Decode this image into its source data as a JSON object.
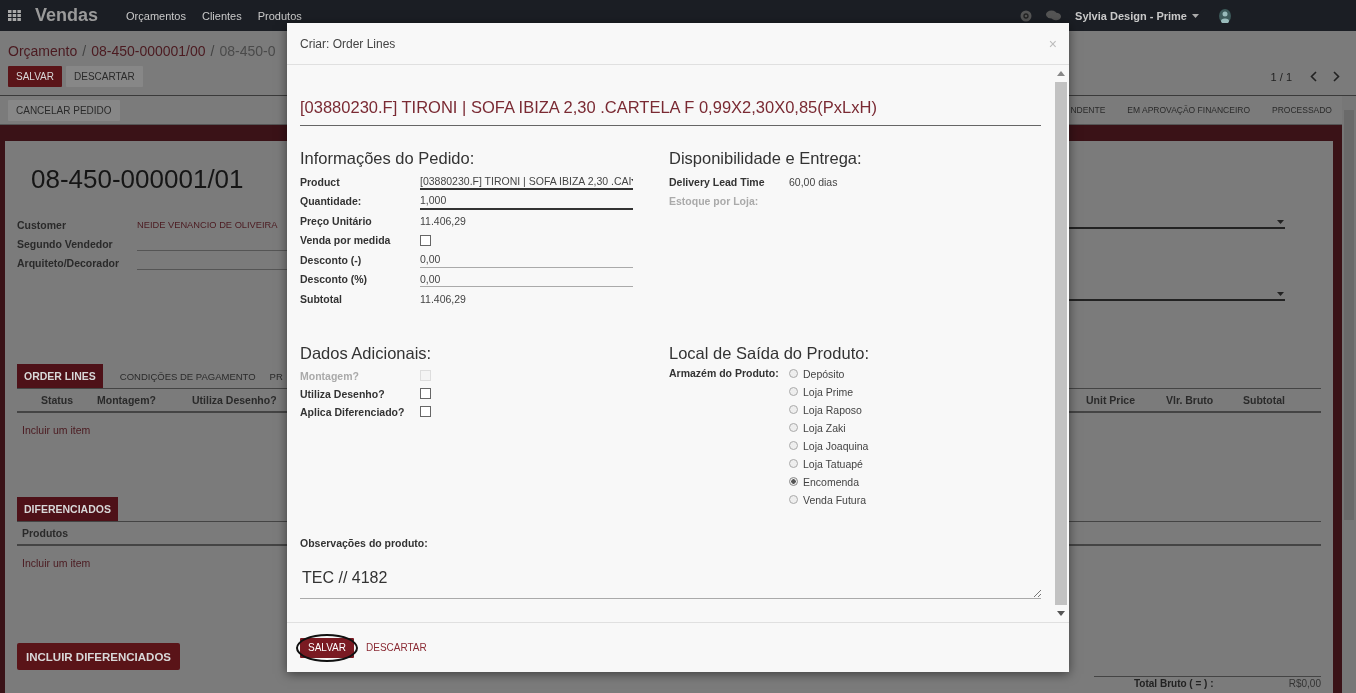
{
  "topbar": {
    "app": "Vendas",
    "menu": [
      "Orçamentos",
      "Clientes",
      "Produtos"
    ],
    "user": "Sylvia Design - Prime"
  },
  "control_panel": {
    "breadcrumb": {
      "separator": "/",
      "items": [
        "Orçamento",
        "08-450-000001/00",
        "08-450-0"
      ]
    },
    "buttons": [
      {
        "label": "SALVAR",
        "kind": "primary"
      },
      {
        "label": "DESCARTAR",
        "kind": "secondary"
      }
    ],
    "pager": "1 / 1"
  },
  "statusbar": {
    "buttons": [
      "CANCELAR PEDIDO"
    ],
    "stages": [
      "NDENTE",
      "EM APROVAÇÃO FINANCEIRO",
      "PROCESSADO"
    ]
  },
  "sheet": {
    "title": "08-450-000001/01",
    "fields": [
      {
        "label": "Customer",
        "value": "NEIDE VENANCIO DE OLIVEIRA"
      },
      {
        "label": "Segundo Vendedor"
      },
      {
        "label": "Arquiteto/Decorador"
      }
    ],
    "tabs": [
      {
        "label": "ORDER LINES",
        "selected": true
      },
      {
        "label": "CONDIÇÕES DE PAGAMENTO",
        "selected": false
      },
      {
        "label": "PR",
        "selected": false
      }
    ],
    "columns_left": [
      "Status",
      "Montagem?",
      "Utiliza Desenho?"
    ],
    "columns_right": [
      "Unit Price",
      "Vlr. Bruto",
      "Subtotal"
    ],
    "add_item": "Incluir um item",
    "diferenciados": {
      "title": "DIFERENCIADOS",
      "columns": [
        "Produtos"
      ],
      "add_item": "Incluir um item"
    },
    "add_button": "INCLUIR DIFERENCIADOS",
    "total": {
      "label": "Total Bruto ( = ) :",
      "value": "R$0,00"
    }
  },
  "dialog": {
    "title": "Criar: Order Lines",
    "close": "×",
    "product_title": "[03880230.F] TIRONI | SOFA IBIZA 2,30 .CARTELA F 0,99X2,30X0,85(PxLxH)",
    "order_info": {
      "heading": "Informações do Pedido:",
      "fields": [
        {
          "label": "Product",
          "kind": "select",
          "value": "[03880230.F] TIRONI | SOFA IBIZA 2,30 .CAI",
          "required": true
        },
        {
          "label": "Quantidade:",
          "kind": "input",
          "value": "1,000",
          "required": true
        },
        {
          "label": "Preço Unitário",
          "kind": "text",
          "value": "11.406,29"
        },
        {
          "label": "Venda por medida",
          "kind": "checkbox",
          "checked": false
        },
        {
          "label": "Desconto (-)",
          "kind": "input",
          "value": "0,00",
          "required": false
        },
        {
          "label": "Desconto (%)",
          "kind": "input",
          "value": "0,00",
          "required": false
        },
        {
          "label": "Subtotal",
          "kind": "text",
          "value": "11.406,29"
        }
      ]
    },
    "availability": {
      "heading": "Disponibilidade e Entrega:",
      "fields": [
        {
          "label": "Delivery Lead Time",
          "value": "60,00 dias",
          "disabled": false
        },
        {
          "label": "Estoque por Loja:",
          "disabled": true
        }
      ]
    },
    "additional": {
      "heading": "Dados Adicionais:",
      "fields": [
        {
          "label": "Montagem?",
          "checked": false,
          "disabled": true
        },
        {
          "label": "Utiliza Desenho?",
          "checked": false,
          "disabled": false
        },
        {
          "label": "Aplica Diferenciado?",
          "checked": false,
          "disabled": false
        }
      ]
    },
    "warehouse": {
      "heading": "Local de Saída do Produto:",
      "label": "Armazém do Produto:",
      "options": [
        {
          "label": "Depósito",
          "selected": false
        },
        {
          "label": "Loja Prime",
          "selected": false
        },
        {
          "label": "Loja Raposo",
          "selected": false
        },
        {
          "label": "Loja Zaki",
          "selected": false
        },
        {
          "label": "Loja Joaquina",
          "selected": false
        },
        {
          "label": "Loja Tatuapé",
          "selected": false
        },
        {
          "label": "Encomenda",
          "selected": true
        },
        {
          "label": "Venda Futura",
          "selected": false
        }
      ]
    },
    "notes": {
      "label": "Observações do produto:",
      "value": "TEC // 4182"
    },
    "buttons": [
      {
        "label": "SALVAR",
        "kind": "primary",
        "circled": true
      },
      {
        "label": "DESCARTAR",
        "kind": "link",
        "circled": false
      }
    ]
  }
}
